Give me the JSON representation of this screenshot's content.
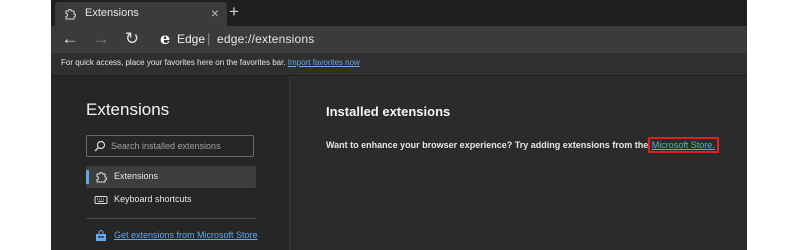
{
  "tab": {
    "title": "Extensions",
    "close": "×",
    "new_tab": "+"
  },
  "toolbar": {
    "back": "←",
    "forward": "→",
    "refresh": "↻",
    "edge_logo": "e",
    "edge_label": "Edge",
    "separator": "|",
    "url": "edge://extensions"
  },
  "favorites_bar": {
    "text": "For quick access, place your favorites here on the favorites bar.",
    "link": "Import favorites now"
  },
  "sidebar": {
    "title": "Extensions",
    "search_placeholder": "Search installed extensions",
    "items": [
      {
        "label": "Extensions",
        "icon": "puzzle-icon",
        "active": true
      },
      {
        "label": "Keyboard shortcuts",
        "icon": "keyboard-icon",
        "active": false
      }
    ],
    "store_link": "Get extensions from Microsoft Store"
  },
  "main": {
    "title": "Installed extensions",
    "description": "Want to enhance your browser experience? Try adding extensions from the",
    "link": "Microsoft Store",
    "link_suffix": "."
  },
  "colors": {
    "accent": "#62a9f0",
    "highlight_box": "#e02020",
    "background": "#2b2b2b"
  }
}
